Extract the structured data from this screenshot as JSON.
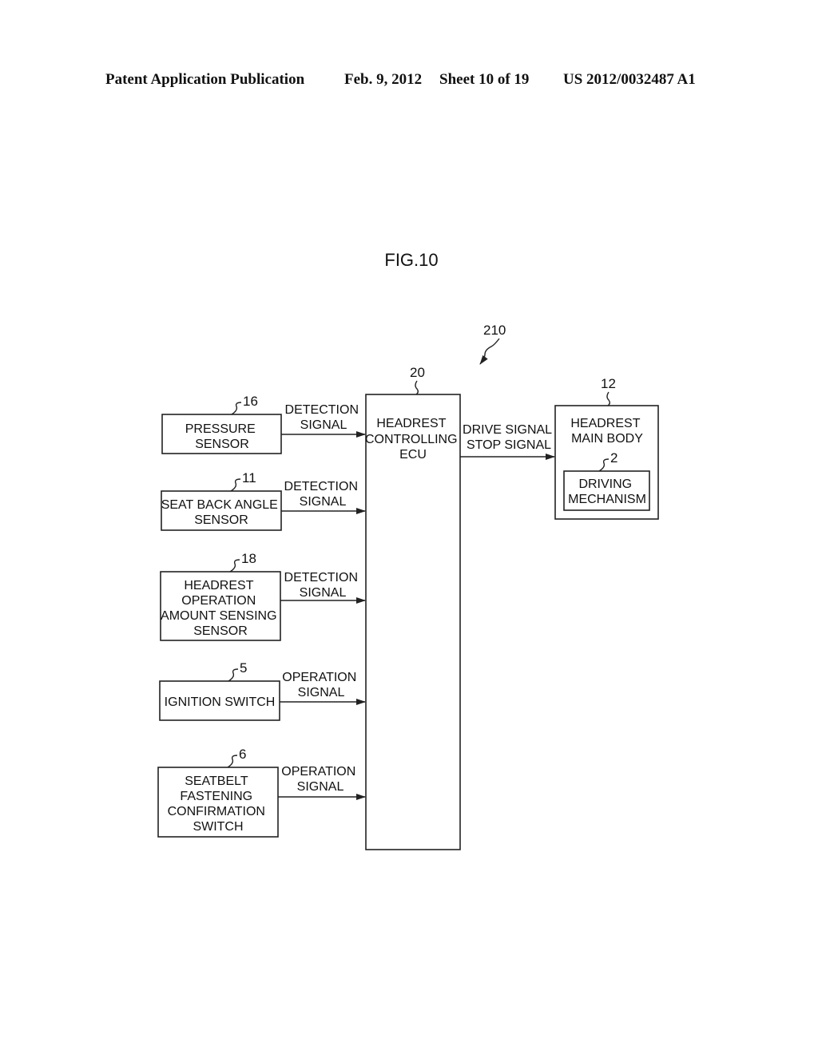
{
  "header": {
    "publication": "Patent Application Publication",
    "date": "Feb. 9, 2012",
    "sheet": "Sheet 10 of 19",
    "number": "US 2012/0032487 A1"
  },
  "figure": {
    "title": "FIG.10",
    "system_ref": "210"
  },
  "blocks": {
    "pressure_sensor": {
      "ref": "16",
      "lines": [
        "PRESSURE",
        "SENSOR"
      ],
      "signal": [
        "DETECTION",
        "SIGNAL"
      ]
    },
    "seat_back_angle_sensor": {
      "ref": "11",
      "lines": [
        "SEAT BACK ANGLE",
        "SENSOR"
      ],
      "signal": [
        "DETECTION",
        "SIGNAL"
      ]
    },
    "headrest_operation_sensor": {
      "ref": "18",
      "lines": [
        "HEADREST",
        "OPERATION",
        "AMOUNT SENSING",
        "SENSOR"
      ],
      "signal": [
        "DETECTION",
        "SIGNAL"
      ]
    },
    "ignition_switch": {
      "ref": "5",
      "lines": [
        "IGNITION SWITCH"
      ],
      "signal": [
        "OPERATION",
        "SIGNAL"
      ]
    },
    "seatbelt_switch": {
      "ref": "6",
      "lines": [
        "SEATBELT",
        "FASTENING",
        "CONFIRMATION",
        "SWITCH"
      ],
      "signal": [
        "OPERATION",
        "SIGNAL"
      ]
    },
    "ecu": {
      "ref": "20",
      "lines": [
        "HEADREST",
        "CONTROLLING",
        "ECU"
      ]
    },
    "output_signal": [
      "DRIVE SIGNAL",
      "STOP SIGNAL"
    ],
    "headrest_main_body": {
      "ref": "12",
      "lines": [
        "HEADREST",
        "MAIN BODY"
      ]
    },
    "driving_mechanism": {
      "ref": "2",
      "lines": [
        "DRIVING",
        "MECHANISM"
      ]
    }
  }
}
